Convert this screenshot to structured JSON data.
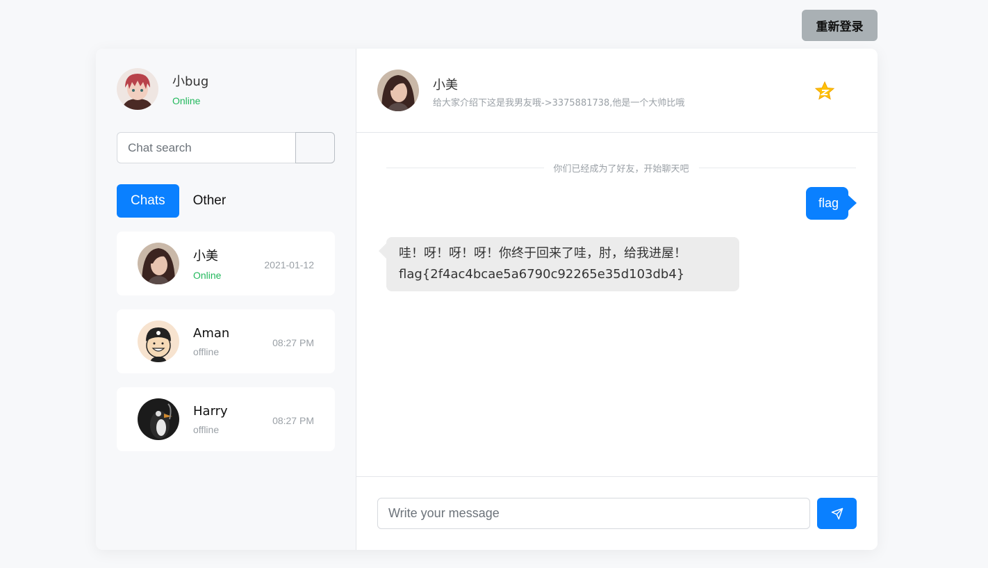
{
  "top": {
    "relogin_label": "重新登录"
  },
  "me": {
    "name": "小bug",
    "status": "Online"
  },
  "search": {
    "placeholder": "Chat search"
  },
  "tabs": [
    {
      "label": "Chats",
      "active": true
    },
    {
      "label": "Other",
      "active": false
    }
  ],
  "chats": [
    {
      "name": "小美",
      "status": "Online",
      "time": "2021-01-12",
      "avatar": "girl-avatar"
    },
    {
      "name": "Aman",
      "status": "offline",
      "time": "08:27 PM",
      "avatar": "cartoon-boy-avatar"
    },
    {
      "name": "Harry",
      "status": "offline",
      "time": "08:27 PM",
      "avatar": "penguin-avatar"
    }
  ],
  "header": {
    "name": "小美",
    "description": "给大家介绍下这是我男友哦->3375881738,他是一个大帅比哦",
    "star_icon": "vip-star-icon"
  },
  "messages": {
    "divider": "你们已经成为了好友，开始聊天吧",
    "outgoing": "flag",
    "incoming": "哇！呀！呀！呀！你终于回来了哇，肘，给我进屋！flag{2f4ac4bcae5a6790c92265e35d103db4}"
  },
  "composer": {
    "placeholder": "Write your message",
    "send_icon": "paper-plane-icon"
  },
  "colors": {
    "accent": "#0a80ff",
    "online": "#22b85c",
    "offline": "#9aa0a6",
    "relogin_bg": "#a9b0b4"
  }
}
